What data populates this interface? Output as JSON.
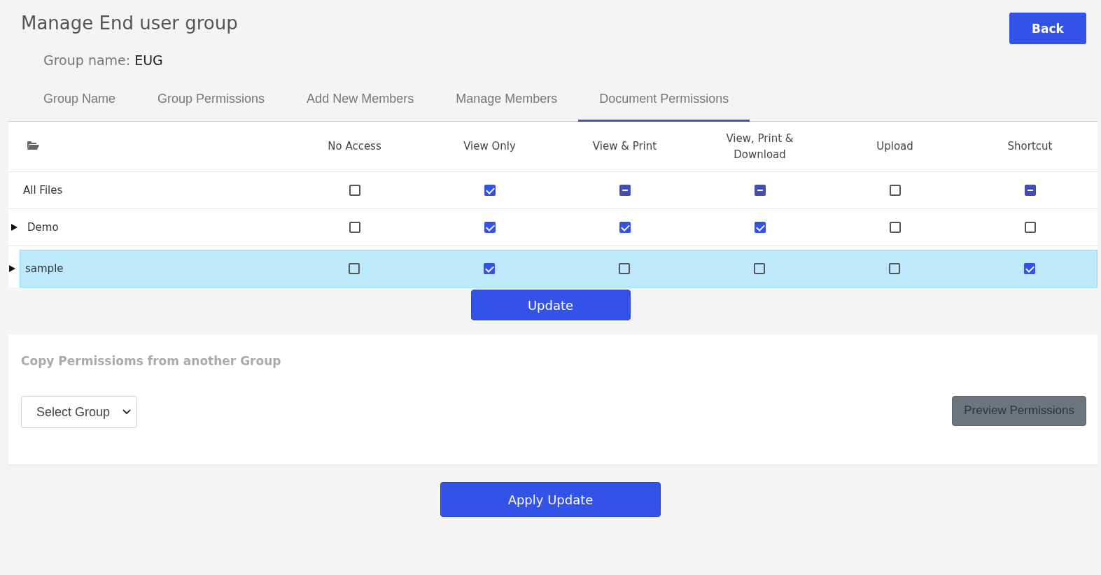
{
  "page": {
    "title": "Manage End user group",
    "group_name_label": "Group name:",
    "group_name": "EUG",
    "back_button": "Back"
  },
  "tabs": [
    {
      "label": "Group Name",
      "selected": false
    },
    {
      "label": "Group Permissions",
      "selected": false
    },
    {
      "label": "Add New Members",
      "selected": false
    },
    {
      "label": "Manage Members",
      "selected": false
    },
    {
      "label": "Document Permissions",
      "selected": true
    }
  ],
  "table": {
    "columns": [
      "No Access",
      "View Only",
      "View & Print",
      "View, Print & Download",
      "Upload",
      "Shortcut"
    ],
    "rows": [
      {
        "name": "All Files",
        "kind": "root",
        "selected": false,
        "cells": [
          {
            "checked": false
          },
          {
            "checked": true
          },
          {
            "checked": true,
            "indeterminate": true
          },
          {
            "checked": true,
            "indeterminate": true
          },
          {
            "checked": false
          },
          {
            "checked": true,
            "indeterminate": true
          }
        ]
      },
      {
        "name": "Demo",
        "kind": "folder",
        "expanded": false,
        "selected": false,
        "cells": [
          {
            "checked": false
          },
          {
            "checked": true
          },
          {
            "checked": true
          },
          {
            "checked": true
          },
          {
            "checked": false
          },
          {
            "checked": false
          }
        ]
      },
      {
        "name": "sample",
        "kind": "folder",
        "expanded": false,
        "selected": true,
        "cells": [
          {
            "checked": false
          },
          {
            "checked": true
          },
          {
            "checked": false
          },
          {
            "checked": false
          },
          {
            "checked": false
          },
          {
            "checked": true
          }
        ]
      }
    ]
  },
  "update_button": "Update",
  "copy_panel": {
    "title": "Copy Permissioms from another Group",
    "select": {
      "value": "Select Group"
    },
    "preview_button": "Preview Permissions"
  },
  "apply_button": "Apply Update"
}
